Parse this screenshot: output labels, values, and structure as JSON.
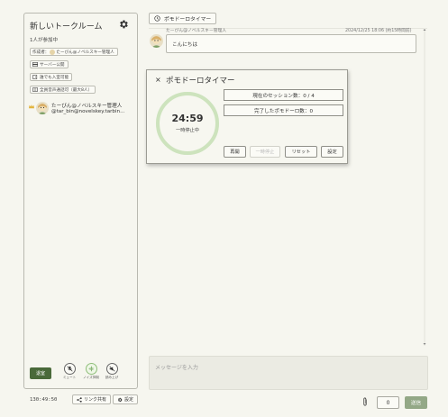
{
  "sidebar": {
    "room_title": "新しいトークルーム",
    "participants": "1人が参加中",
    "pills": {
      "creator_prefix": "作成者：",
      "creator_name": "たーびん@ノベルスキー管理人",
      "server_public": "サーバー公開",
      "anyone_can_join": "誰でも入室可能",
      "voice_all": "全員音声通話可（最大8人）"
    },
    "member": {
      "name": "たーびん@ノベルスキー管理人",
      "id": "@tar_bin@novelskey.tarbin..."
    },
    "leave_label": "退室",
    "controls": {
      "mute": "ミュート",
      "noise": "ノイズ抑制",
      "hand": "読み上げ"
    }
  },
  "footer_left": {
    "clock": "130:49:50",
    "share_label": "リンク共有",
    "settings_label": "設定"
  },
  "timer_button_label": "ポモドーロタイマー",
  "message": {
    "author": "たーびん@ノベルスキー管理人",
    "timestamp": "2024/12/25 18:06 (約15時間前)",
    "text": "こんにちは"
  },
  "pomodoro": {
    "title": "ポモドーロタイマー",
    "close": "×",
    "time": "24:59",
    "status": "一時停止中",
    "session_label": "現在のセッション数：0 / 4",
    "completed_label": "完了したポモドーロ数：0",
    "progress_fraction": 0.999,
    "buttons": {
      "resume": "再開",
      "pause": "一時停止",
      "reset": "リセット",
      "settings": "設定"
    }
  },
  "composer": {
    "placeholder": "メッセージを入力",
    "count": "0",
    "send": "送信"
  },
  "colors": {
    "accent_dark": "#4a6a3a",
    "ring": "#cde3bd",
    "send_bg": "#93a886"
  }
}
